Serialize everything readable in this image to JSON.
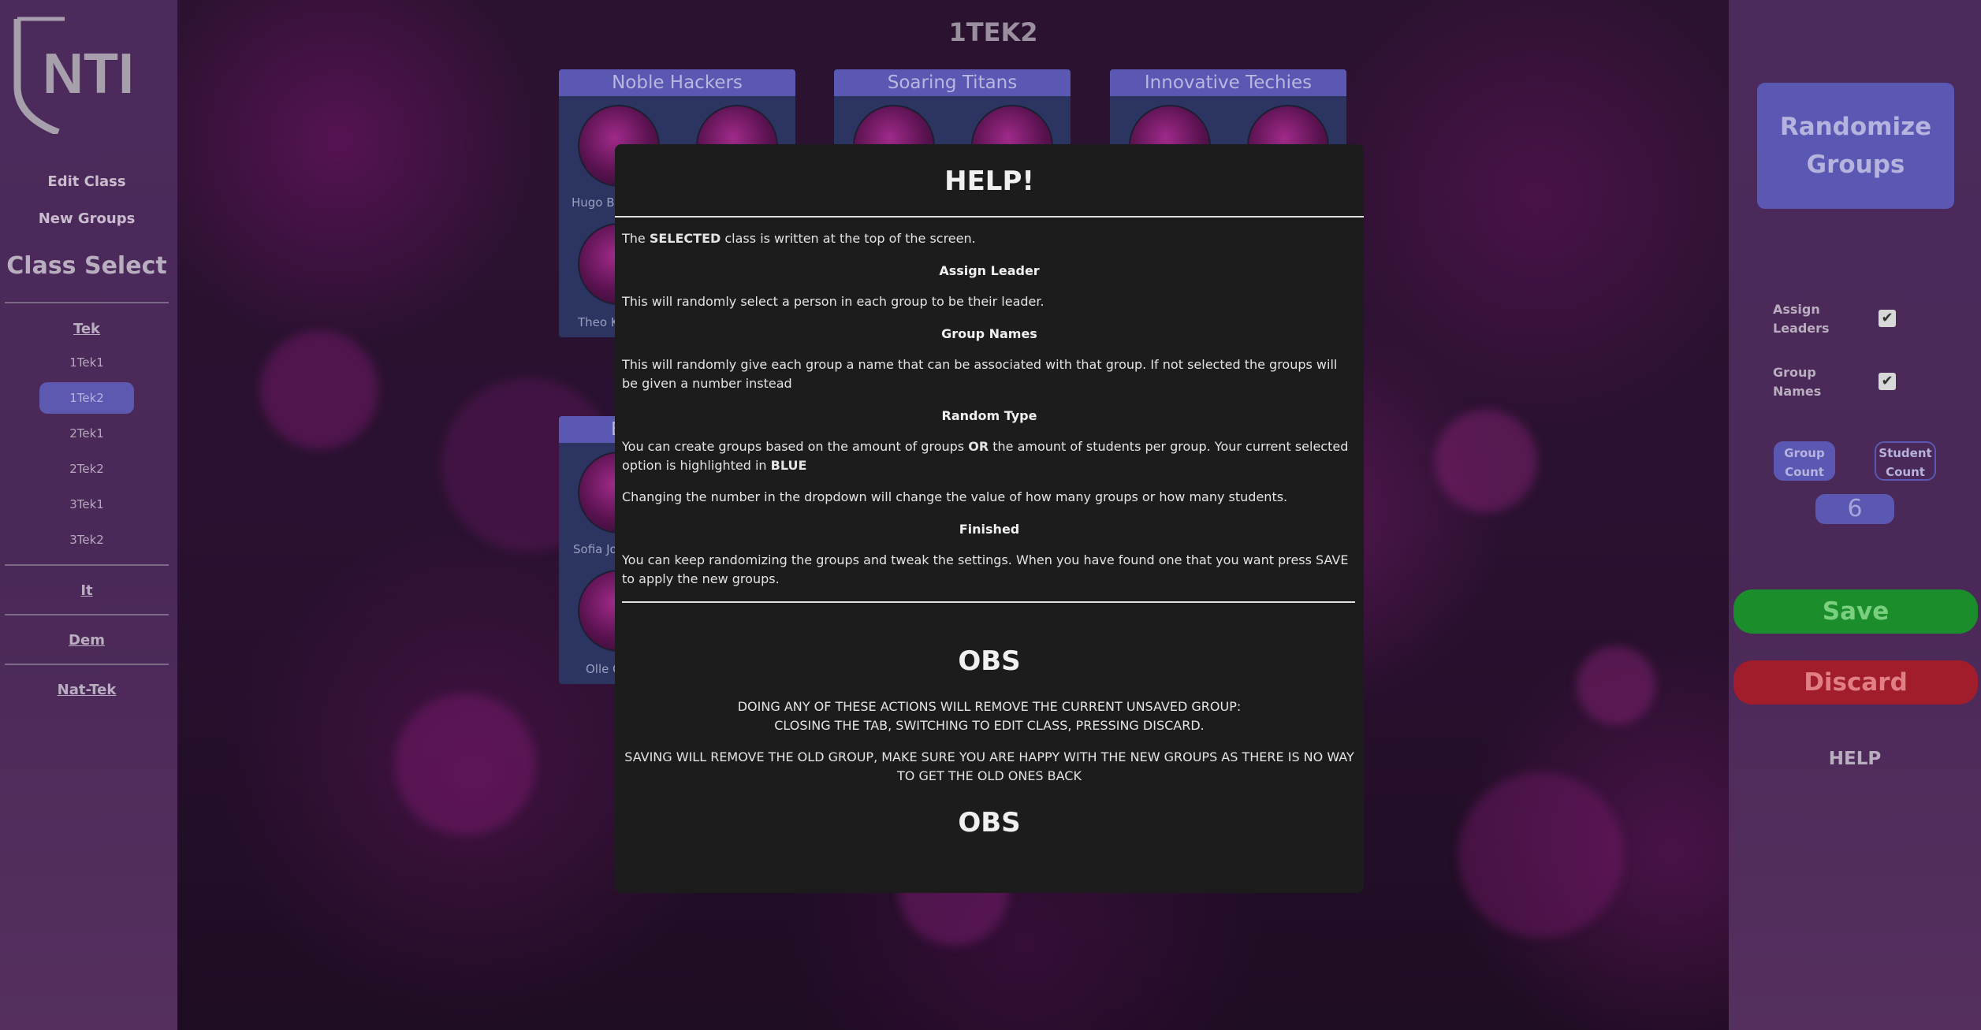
{
  "app": {
    "logo_text": "NTI",
    "class_title": "1TEK2"
  },
  "sidebar": {
    "edit_class": "Edit Class",
    "new_groups": "New Groups",
    "class_select_title": "Class Select",
    "categories": [
      {
        "label": "Tek"
      },
      {
        "label": "It"
      },
      {
        "label": "Dem"
      },
      {
        "label": "Nat-Tek"
      }
    ],
    "tek_classes": [
      "1Tek1",
      "1Tek2",
      "2Tek1",
      "2Tek2",
      "3Tek1",
      "3Tek2"
    ],
    "selected_class": "1Tek2"
  },
  "groups": [
    {
      "name": "Noble Hackers",
      "members": [
        "Hugo Be",
        "Theo K"
      ]
    },
    {
      "name": "Soaring Titans",
      "members": []
    },
    {
      "name": "Innovative Techies",
      "members": []
    },
    {
      "name": "E",
      "members": [
        "Sofia Jo",
        "Olle C"
      ]
    }
  ],
  "help": {
    "title": "HELP!",
    "intro_prefix": "The ",
    "intro_bold": "SELECTED",
    "intro_suffix": " class is written at the top of the screen.",
    "assign_leader_heading": "Assign Leader",
    "assign_leader_text": "This will randomly select a person in each group to be their leader.",
    "group_names_heading": "Group Names",
    "group_names_text": "This will randomly give each group a name that can be associated with that group. If not selected the groups will be given a number instead",
    "random_type_heading": "Random Type",
    "random_type_text_1": "You can create groups based on the amount of groups ",
    "random_type_or": "OR",
    "random_type_text_2": " the amount of students per group. Your current selected option is highlighted in ",
    "random_type_blue": "BLUE",
    "dropdown_text": "Changing the number in the dropdown will change the value of how many groups or how many students.",
    "finished_heading": "Finished",
    "finished_text": "You can keep randomizing the groups and tweak the settings. When you have found one that you want press SAVE to apply the new groups.",
    "obs_title": "OBS",
    "warning_line_1": "DOING ANY OF THESE ACTIONS WILL REMOVE THE CURRENT UNSAVED GROUP:",
    "warning_line_2": "CLOSING THE TAB, SWITCHING TO EDIT CLASS, PRESSING DISCARD.",
    "saving_warning": "SAVING WILL REMOVE THE OLD GROUP, MAKE SURE YOU ARE HAPPY WITH THE NEW GROUPS AS THERE IS NO WAY TO GET THE OLD ONES BACK",
    "obs_footer": "OBS"
  },
  "controls": {
    "randomize_line1": "Randomize",
    "randomize_line2": "Groups",
    "assign_leaders_line1": "Assign",
    "assign_leaders_line2": "Leaders",
    "assign_leaders_checked": true,
    "group_names_line1": "Group",
    "group_names_line2": "Names",
    "group_names_checked": true,
    "group_count_line1": "Group",
    "group_count_line2": "Count",
    "student_count_line1": "Student",
    "student_count_line2": "Count",
    "selected_random_type": "Group Count",
    "count_value": "6",
    "save_label": "Save",
    "discard_label": "Discard",
    "help_label": "HELP",
    "checkmark": "✔"
  },
  "colors": {
    "accent_blue": "#5a58b2",
    "save_green": "#1b8e2b",
    "discard_red": "#a11d2c",
    "modal_bg": "#1c1c1c"
  }
}
